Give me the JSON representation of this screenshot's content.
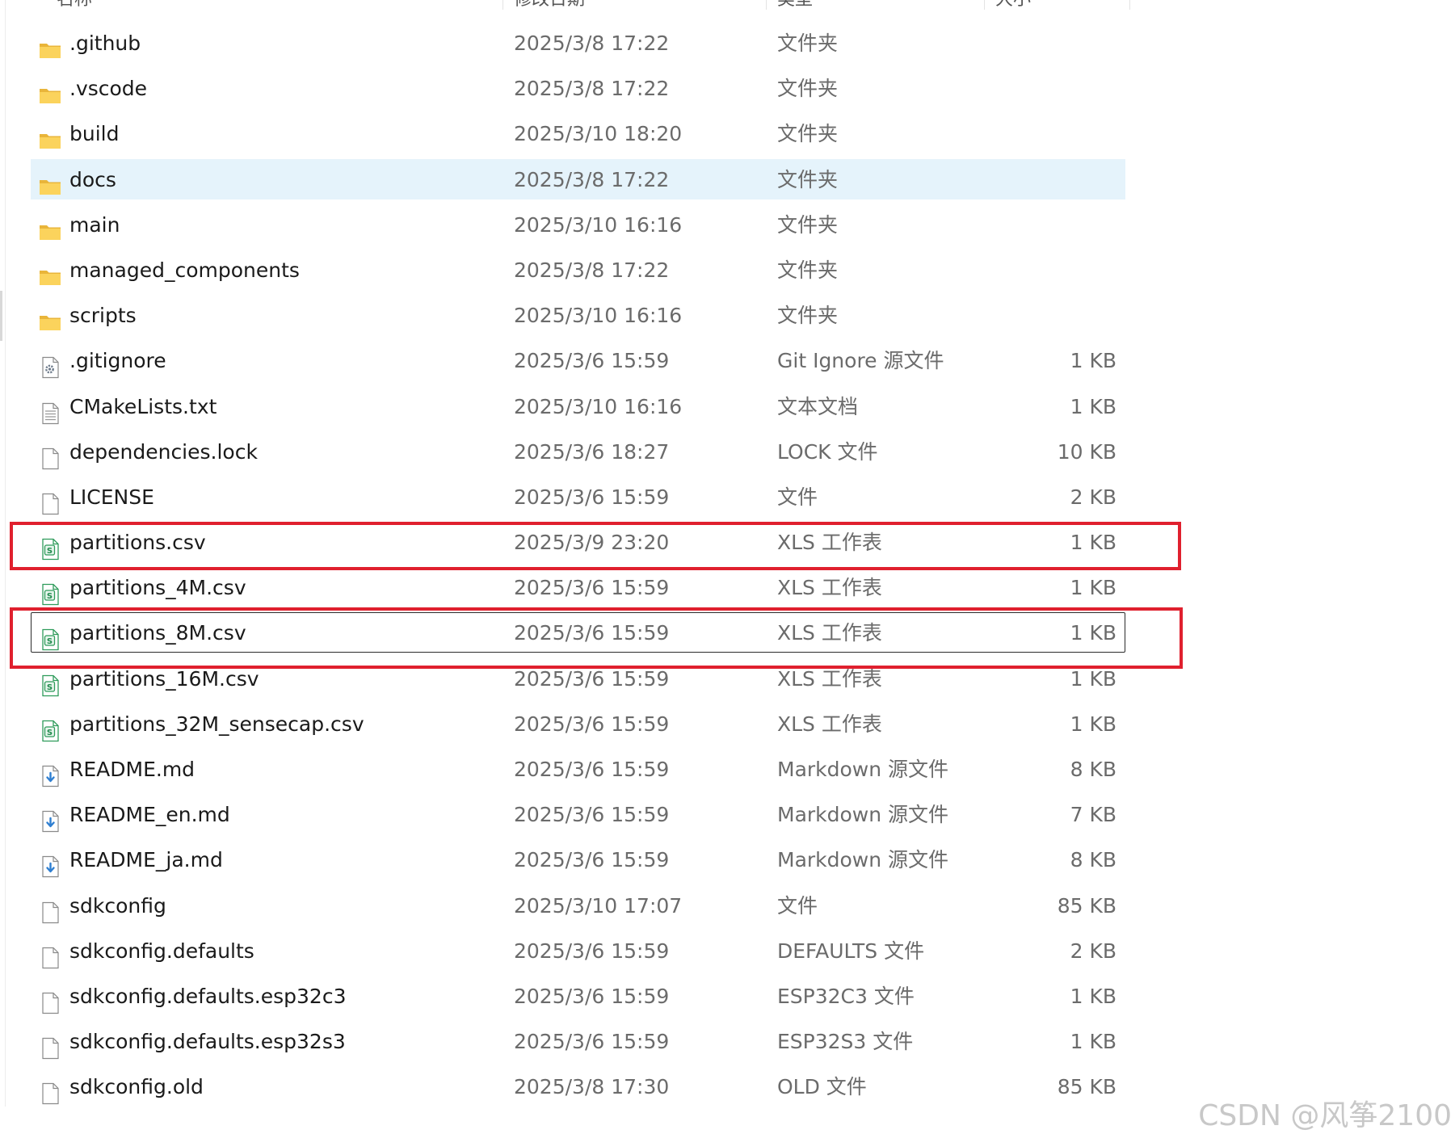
{
  "header": {
    "columns": [
      "名称",
      "修改日期",
      "类型",
      "大小"
    ]
  },
  "files": [
    {
      "name": ".github",
      "date": "2025/3/8 17:22",
      "type": "文件夹",
      "size": "",
      "icon": "folder-icon"
    },
    {
      "name": ".vscode",
      "date": "2025/3/8 17:22",
      "type": "文件夹",
      "size": "",
      "icon": "folder-icon"
    },
    {
      "name": "build",
      "date": "2025/3/10 18:20",
      "type": "文件夹",
      "size": "",
      "icon": "folder-icon"
    },
    {
      "name": "docs",
      "date": "2025/3/8 17:22",
      "type": "文件夹",
      "size": "",
      "icon": "folder-icon",
      "state": "hover"
    },
    {
      "name": "main",
      "date": "2025/3/10 16:16",
      "type": "文件夹",
      "size": "",
      "icon": "folder-icon"
    },
    {
      "name": "managed_components",
      "date": "2025/3/8 17:22",
      "type": "文件夹",
      "size": "",
      "icon": "folder-icon"
    },
    {
      "name": "scripts",
      "date": "2025/3/10 16:16",
      "type": "文件夹",
      "size": "",
      "icon": "folder-icon"
    },
    {
      "name": ".gitignore",
      "date": "2025/3/6 15:59",
      "type": "Git Ignore 源文件",
      "size": "1 KB",
      "icon": "settings-file-icon"
    },
    {
      "name": "CMakeLists.txt",
      "date": "2025/3/10 16:16",
      "type": "文本文档",
      "size": "1 KB",
      "icon": "text-file-icon"
    },
    {
      "name": "dependencies.lock",
      "date": "2025/3/6 18:27",
      "type": "LOCK 文件",
      "size": "10 KB",
      "icon": "file-icon"
    },
    {
      "name": "LICENSE",
      "date": "2025/3/6 15:59",
      "type": "文件",
      "size": "2 KB",
      "icon": "file-icon"
    },
    {
      "name": "partitions.csv",
      "date": "2025/3/9 23:20",
      "type": "XLS 工作表",
      "size": "1 KB",
      "icon": "spreadsheet-icon",
      "highlight": true
    },
    {
      "name": "partitions_4M.csv",
      "date": "2025/3/6 15:59",
      "type": "XLS 工作表",
      "size": "1 KB",
      "icon": "spreadsheet-icon"
    },
    {
      "name": "partitions_8M.csv",
      "date": "2025/3/6 15:59",
      "type": "XLS 工作表",
      "size": "1 KB",
      "icon": "spreadsheet-icon",
      "highlight": true,
      "state": "focus"
    },
    {
      "name": "partitions_16M.csv",
      "date": "2025/3/6 15:59",
      "type": "XLS 工作表",
      "size": "1 KB",
      "icon": "spreadsheet-icon"
    },
    {
      "name": "partitions_32M_sensecap.csv",
      "date": "2025/3/6 15:59",
      "type": "XLS 工作表",
      "size": "1 KB",
      "icon": "spreadsheet-icon"
    },
    {
      "name": "README.md",
      "date": "2025/3/6 15:59",
      "type": "Markdown 源文件",
      "size": "8 KB",
      "icon": "markdown-file-icon"
    },
    {
      "name": "README_en.md",
      "date": "2025/3/6 15:59",
      "type": "Markdown 源文件",
      "size": "7 KB",
      "icon": "markdown-file-icon"
    },
    {
      "name": "README_ja.md",
      "date": "2025/3/6 15:59",
      "type": "Markdown 源文件",
      "size": "8 KB",
      "icon": "markdown-file-icon"
    },
    {
      "name": "sdkconfig",
      "date": "2025/3/10 17:07",
      "type": "文件",
      "size": "85 KB",
      "icon": "file-icon"
    },
    {
      "name": "sdkconfig.defaults",
      "date": "2025/3/6 15:59",
      "type": "DEFAULTS 文件",
      "size": "2 KB",
      "icon": "file-icon"
    },
    {
      "name": "sdkconfig.defaults.esp32c3",
      "date": "2025/3/6 15:59",
      "type": "ESP32C3 文件",
      "size": "1 KB",
      "icon": "file-icon"
    },
    {
      "name": "sdkconfig.defaults.esp32s3",
      "date": "2025/3/6 15:59",
      "type": "ESP32S3 文件",
      "size": "1 KB",
      "icon": "file-icon"
    },
    {
      "name": "sdkconfig.old",
      "date": "2025/3/8 17:30",
      "type": "OLD 文件",
      "size": "85 KB",
      "icon": "file-icon"
    }
  ],
  "watermark": "CSDN @风筝2100",
  "colors": {
    "highlight": "#e0202e",
    "hover_bg": "#e5f3fb",
    "folder": "#f8c84a"
  }
}
